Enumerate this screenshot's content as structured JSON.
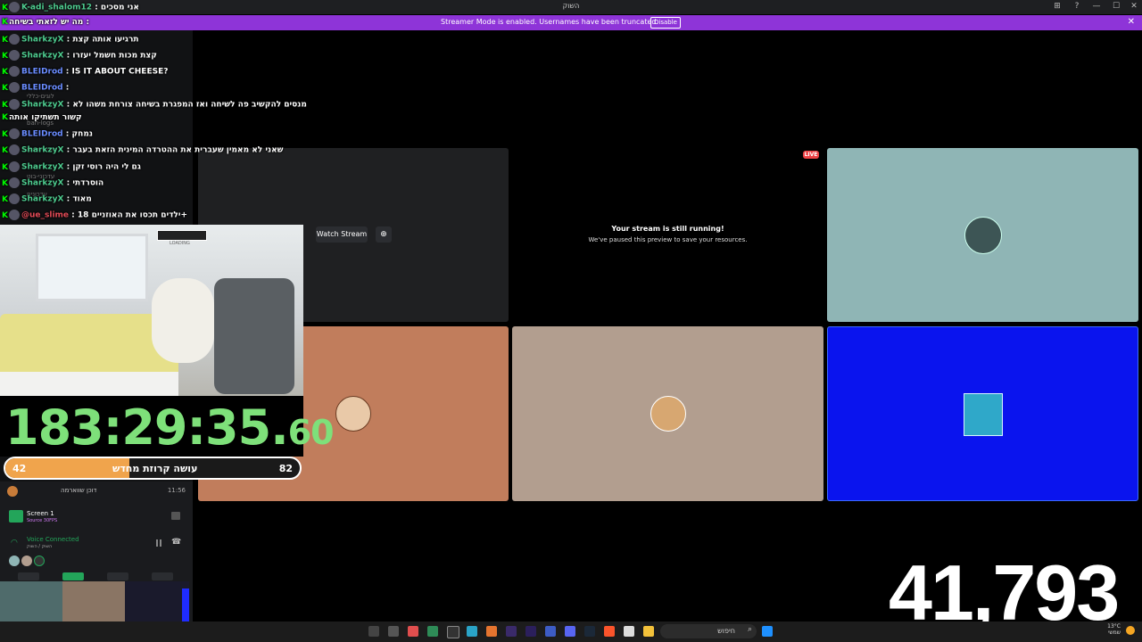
{
  "window": {
    "title": "השוק",
    "buttons": [
      "⊞",
      "?",
      "—",
      "☐",
      "✕"
    ]
  },
  "banner": {
    "message": "Streamer Mode is enabled. Usernames have been truncated.",
    "disable_label": "Disable"
  },
  "chat": [
    {
      "user": "K-adi_shalom12",
      "text": ": אני מסכים",
      "color": "green"
    },
    {
      "user": "",
      "text": "מה יש לזאתי בשיחה :",
      "color": "green"
    },
    {
      "user": "SharkzyX",
      "text": ": תרגיעו אותה קצת",
      "color": "green"
    },
    {
      "user": "SharkzyX",
      "text": ": קצת מכות חשמל יעזרו",
      "color": "green"
    },
    {
      "user": "BLEIDrod",
      "text": ": IS IT ABOUT CHEESE?",
      "color": "blue"
    },
    {
      "user": "BLEIDrod",
      "text": ":",
      "color": "blue"
    },
    {
      "user": "SharkzyX",
      "text": ": מנסים להקשיב פה לשיחה ואז המפגרת בשיחה צורחת משהו לא",
      "color": "green"
    },
    {
      "user": "",
      "text": "קשור תשתיקו אותה",
      "color": "green"
    },
    {
      "user": "BLEIDrod",
      "text": ": נמחק",
      "color": "blue"
    },
    {
      "user": "SharkzyX",
      "text": ": שאני לא מאמין שעברית את ההטרדה המינית הזאת בעבר",
      "color": "green"
    },
    {
      "user": "SharkzyX",
      "text": ": גם לי היה רוסי זקן",
      "color": "green"
    },
    {
      "user": "SharkzyX",
      "text": ": הוסרדתי",
      "color": "green"
    },
    {
      "user": "SharkzyX",
      "text": ": מאוד",
      "color": "green"
    },
    {
      "user": "@ue_slime",
      "text": ": ילדים תכסו את האוזניים 18+",
      "color": "red"
    }
  ],
  "webcam": {
    "loading_text": "LOADING"
  },
  "timer": {
    "main": "183:29:35.",
    "fraction": "60"
  },
  "progress": {
    "left": "42",
    "right": "82",
    "label": "עושה קרוזת מחדש",
    "fraction": 0.42
  },
  "sidebar": {
    "user_row": "דוכן שווארמה",
    "user_time": "11:56",
    "screen_title": "Screen 1",
    "screen_sub": "Source 30FPS",
    "voice_title": "Voice Connected",
    "voice_sub": "השוק / השוק"
  },
  "stage": {
    "watch_label": "Watch Stream",
    "live_label": "LIVE",
    "paused_title": "Your stream is still running!",
    "paused_sub": "We've paused this preview to save your resources."
  },
  "counter": "41,793",
  "taskbar": {
    "search_placeholder": "חיפוש",
    "temp": "13°C",
    "weather": "שמשי"
  },
  "colors": {
    "banner": "#8e34d8",
    "tile_teal": "#8fb5b5",
    "tile_orange": "#c17d5c",
    "tile_beige": "#b29e8f",
    "tile_blue": "#0a14ee",
    "timer_green": "#7ee07a",
    "progress_orange": "#f0a44c"
  }
}
